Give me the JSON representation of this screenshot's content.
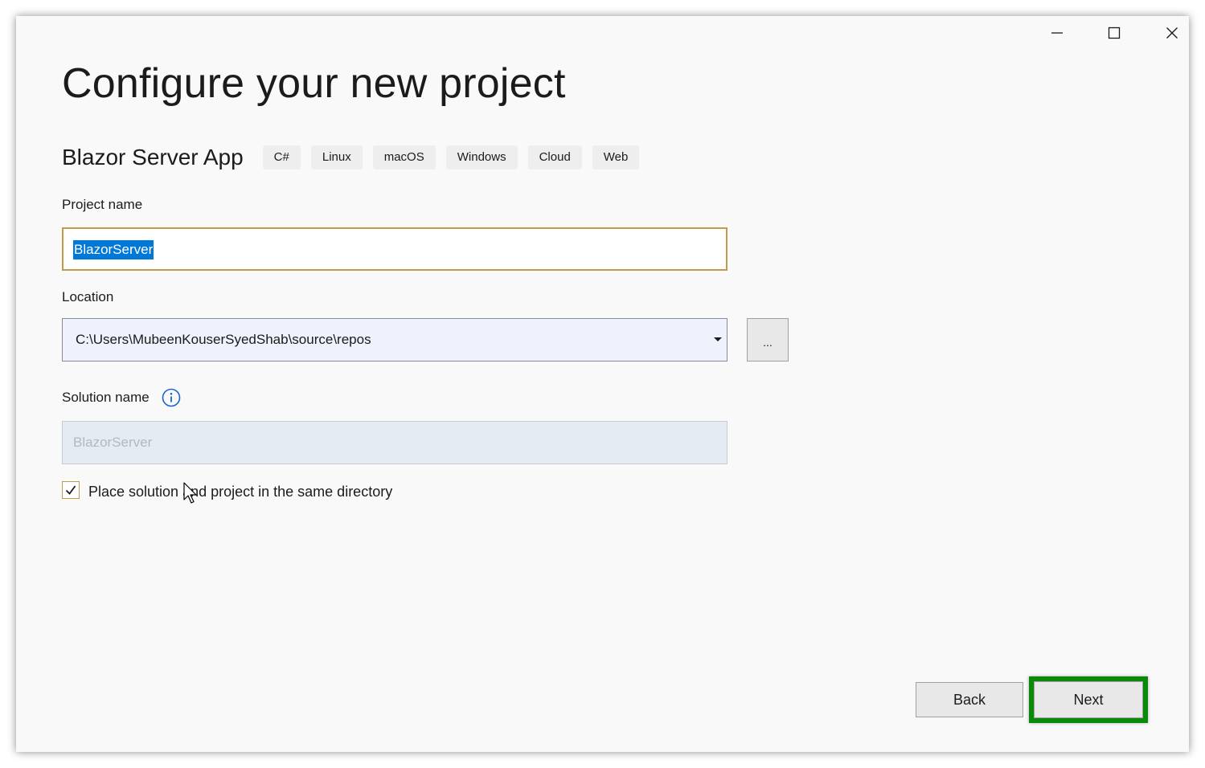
{
  "window": {
    "controls": {
      "minimize": "minimize",
      "maximize": "maximize",
      "close": "close"
    }
  },
  "page_title": "Configure your new project",
  "template": {
    "name": "Blazor Server App",
    "tags": [
      "C#",
      "Linux",
      "macOS",
      "Windows",
      "Cloud",
      "Web"
    ]
  },
  "project_name": {
    "label": "Project name",
    "value": "BlazorServer"
  },
  "location": {
    "label": "Location",
    "value": "C:\\Users\\MubeenKouserSyedShab\\source\\repos",
    "browse_label": "..."
  },
  "solution_name": {
    "label": "Solution name",
    "placeholder": "BlazorServer"
  },
  "same_directory": {
    "label": "Place solution and project in the same directory",
    "checked": true
  },
  "buttons": {
    "back": "Back",
    "next": "Next"
  },
  "colors": {
    "accent_border": "#c39a48",
    "selection": "#0078d7",
    "highlight": "#0a8a0a"
  }
}
